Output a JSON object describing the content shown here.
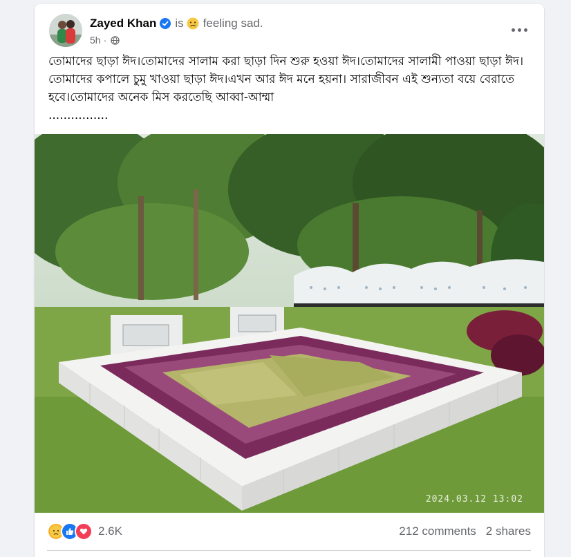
{
  "post": {
    "author": "Zayed Khan",
    "is_word": "is",
    "feeling_text": "feeling sad.",
    "time": "5h",
    "privacy_icon": "globe-icon",
    "verified_icon": "verified-badge-icon",
    "feeling_icon": "sad-face-icon",
    "more_icon": "more-options-icon",
    "text": "তোমাদের ছাড়া ঈদ।তোমাদের সালাম করা ছাড়া দিন শুরু হওয়া ঈদ।তোমাদের সালামী পাওয়া ছাড়া ঈদ।তোমাদের কপালে চুমু খাওয়া ছাড়া ঈদ।এখন আর ঈদ মনে হয়না। সারাজীবন এই শুন্যতা বয়ে বেরাতে হবে।তোমাদের অনেক মিস করতেছি আব্বা-আম্মা\n................",
    "photo_timestamp": "2024.03.12 13:02"
  },
  "stats": {
    "reactions_count": "2.6K",
    "reaction_icons": [
      "sad-reaction-icon",
      "like-reaction-icon",
      "love-reaction-icon"
    ],
    "comments": "212 comments",
    "shares": "2 shares"
  },
  "colors": {
    "like_blue": "#1877f2",
    "love_red": "#f33e58",
    "sad_yellow": "#f7b125",
    "muted_text": "#65676b"
  }
}
